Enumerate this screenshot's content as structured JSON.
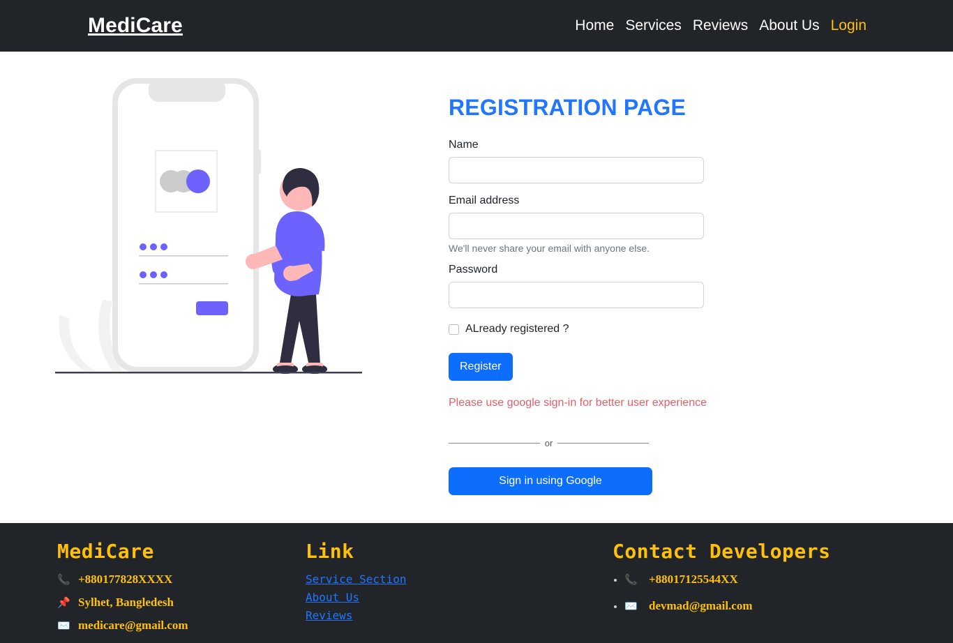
{
  "navbar": {
    "brand": "MediCare",
    "links": [
      {
        "label": "Home",
        "accent": false
      },
      {
        "label": "Services",
        "accent": false
      },
      {
        "label": "Reviews",
        "accent": false
      },
      {
        "label": "About Us",
        "accent": false
      },
      {
        "label": "Login",
        "accent": true
      }
    ]
  },
  "illustration": {
    "name": "mobile-login-illustration",
    "colors": {
      "accent": "#6c63ff",
      "device": "#e6e6e6",
      "skin": "#ffb8b8",
      "hair": "#2f2e41",
      "ground": "#3f3d56"
    }
  },
  "form": {
    "title": "REGISTRATION PAGE",
    "name": {
      "label": "Name",
      "value": "",
      "placeholder": ""
    },
    "email": {
      "label": "Email address",
      "value": "",
      "placeholder": "",
      "help": "We'll never share your email with anyone else."
    },
    "password": {
      "label": "Password",
      "value": "",
      "placeholder": ""
    },
    "checkbox": {
      "label": "ALready registered ?",
      "checked": false
    },
    "register_button": "Register",
    "warning": "Please use google sign-in for better user experience",
    "divider_word": "or",
    "google_button": "Sign in using Google",
    "colors": {
      "title": "#2176ff",
      "primary": "#0d6efd",
      "warning": "#e35d6a"
    }
  },
  "footer": {
    "brand_column": {
      "heading": "MediCare",
      "items": [
        {
          "icon": "phone-icon",
          "glyph": "📞",
          "value": "+880177828XXXX"
        },
        {
          "icon": "pin-icon",
          "glyph": "📌",
          "value": "Sylhet, Bangledesh"
        },
        {
          "icon": "envelope-icon",
          "glyph": "✉️",
          "value": "medicare@gmail.com"
        }
      ]
    },
    "link_column": {
      "heading": "Link",
      "links": [
        "Service Section",
        "About Us",
        "Reviews"
      ]
    },
    "developer_column": {
      "heading": "Contact Developers",
      "items": [
        {
          "icon": "phone-icon",
          "glyph": "📞",
          "value": "+88017125544XX"
        },
        {
          "icon": "envelope-icon",
          "glyph": "✉️",
          "value": "devmad@gmail.com"
        }
      ]
    },
    "colors": {
      "background": "#212529",
      "heading": "#ffc107",
      "link": "#2176ff",
      "value": "#ffc107"
    }
  }
}
